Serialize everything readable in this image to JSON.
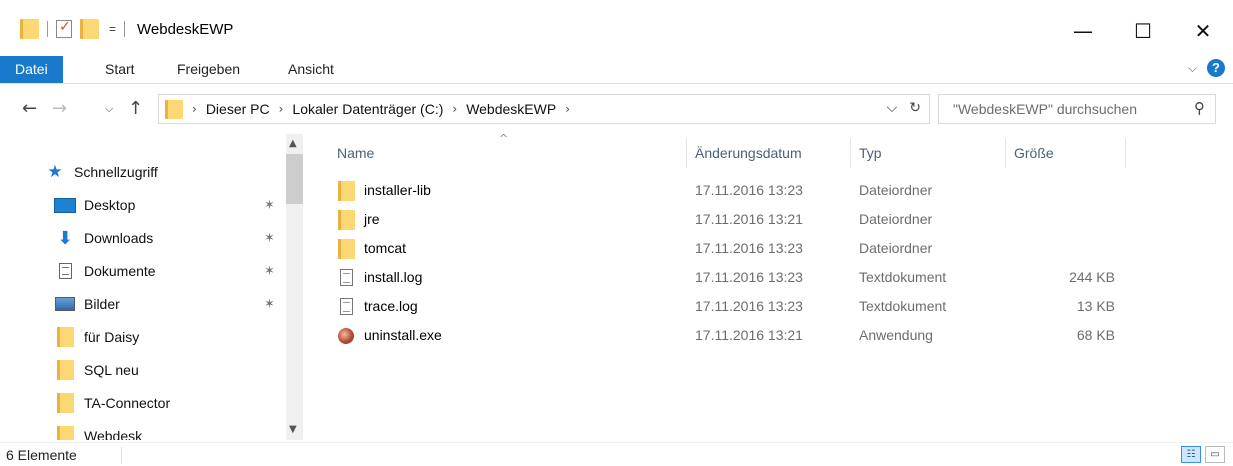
{
  "window": {
    "title": "WebdeskEWP",
    "qat_dropdown": "=",
    "minimize": "—",
    "maximize": "☐",
    "close": "✕"
  },
  "ribbon": {
    "tabs": [
      "Datei",
      "Start",
      "Freigeben",
      "Ansicht"
    ],
    "expand": "⌵",
    "help": "?"
  },
  "nav": {
    "back": "←",
    "forward": "→",
    "recent": "⌵",
    "up": "↑",
    "breadcrumb": [
      "Dieser PC",
      "Lokaler Datenträger (C:)",
      "WebdeskEWP"
    ],
    "crumb_sep": "›",
    "dropdown": "⌵",
    "refresh": "↻",
    "search_placeholder": "\"WebdeskEWP\" durchsuchen",
    "search_icon": "⚲"
  },
  "sidebar": {
    "quick_access": "Schnellzugriff",
    "items": [
      {
        "label": "Desktop",
        "icon": "desktop-icon",
        "pinned": true
      },
      {
        "label": "Downloads",
        "icon": "downloads-icon",
        "pinned": true
      },
      {
        "label": "Dokumente",
        "icon": "documents-icon",
        "pinned": true
      },
      {
        "label": "Bilder",
        "icon": "pictures-icon",
        "pinned": true
      },
      {
        "label": "für Daisy",
        "icon": "folder-icon",
        "pinned": false
      },
      {
        "label": "SQL neu",
        "icon": "folder-icon",
        "pinned": false
      },
      {
        "label": "TA-Connector",
        "icon": "folder-icon",
        "pinned": false
      },
      {
        "label": "Webdesk",
        "icon": "folder-icon",
        "pinned": false
      }
    ],
    "pin_glyph": "✶"
  },
  "list": {
    "columns": [
      "Name",
      "Änderungsdatum",
      "Typ",
      "Größe"
    ],
    "sort_glyph": "^",
    "files": [
      {
        "name": "installer-lib",
        "date": "17.11.2016 13:23",
        "type": "Dateiordner",
        "size": "",
        "icon": "folder-icon"
      },
      {
        "name": "jre",
        "date": "17.11.2016 13:21",
        "type": "Dateiordner",
        "size": "",
        "icon": "folder-icon"
      },
      {
        "name": "tomcat",
        "date": "17.11.2016 13:23",
        "type": "Dateiordner",
        "size": "",
        "icon": "folder-icon"
      },
      {
        "name": "install.log",
        "date": "17.11.2016 13:23",
        "type": "Textdokument",
        "size": "244 KB",
        "icon": "text-file-icon"
      },
      {
        "name": "trace.log",
        "date": "17.11.2016 13:23",
        "type": "Textdokument",
        "size": "13 KB",
        "icon": "text-file-icon"
      },
      {
        "name": "uninstall.exe",
        "date": "17.11.2016 13:21",
        "type": "Anwendung",
        "size": "68 KB",
        "icon": "exe-icon"
      }
    ]
  },
  "status": {
    "count": "6 Elemente",
    "view_details": "☷",
    "view_large": "▭"
  },
  "colors": {
    "accent": "#1979ca",
    "folder": "#fcd874",
    "header_text": "#4c607a"
  }
}
